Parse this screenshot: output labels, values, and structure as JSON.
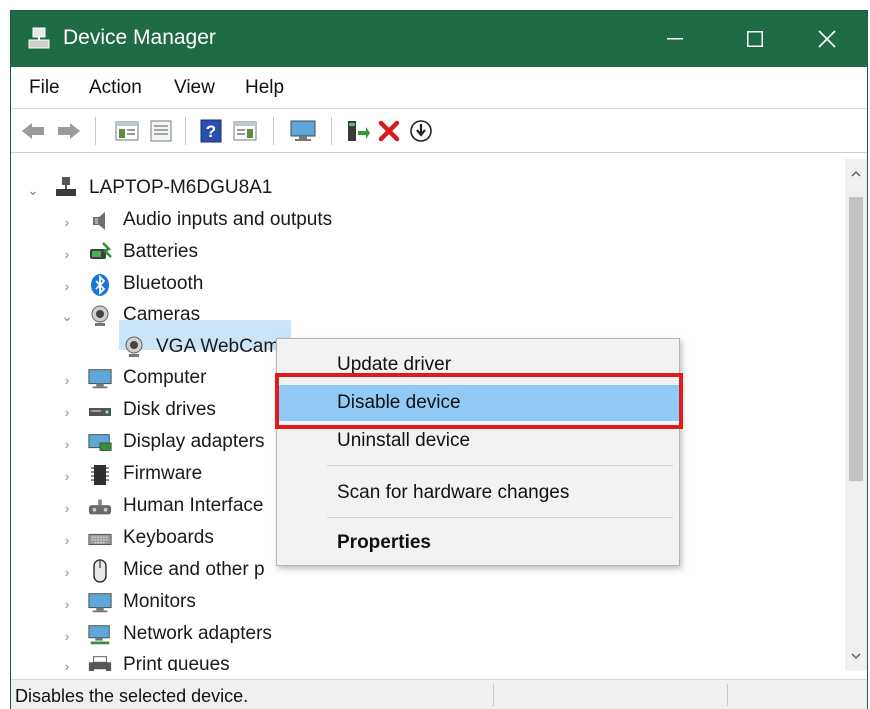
{
  "window": {
    "title": "Device Manager"
  },
  "menubar": {
    "items": [
      "File",
      "Action",
      "View",
      "Help"
    ]
  },
  "toolbar": {
    "buttons": [
      "back-icon",
      "forward-icon",
      "show-hide-console-tree-icon",
      "properties-icon",
      "help-icon",
      "action-pane-icon",
      "monitor-icon",
      "update-driver-icon",
      "uninstall-icon",
      "disable-icon"
    ]
  },
  "tree": {
    "root": "LAPTOP-M6DGU8A1",
    "items": [
      {
        "label": "Audio inputs and outputs",
        "icon": "speaker-icon"
      },
      {
        "label": "Batteries",
        "icon": "battery-icon"
      },
      {
        "label": "Bluetooth",
        "icon": "bluetooth-icon"
      },
      {
        "label": "Cameras",
        "icon": "camera-icon",
        "expanded": true
      },
      {
        "label": "VGA WebCam",
        "icon": "webcam-icon",
        "selected": true
      },
      {
        "label": "Computer",
        "icon": "computer-icon"
      },
      {
        "label": "Disk drives",
        "icon": "disk-icon"
      },
      {
        "label": "Display adapters",
        "icon": "display-adapter-icon"
      },
      {
        "label": "Firmware",
        "icon": "firmware-icon"
      },
      {
        "label": "Human Interface",
        "icon": "hid-icon"
      },
      {
        "label": "Keyboards",
        "icon": "keyboard-icon"
      },
      {
        "label": "Mice and other p",
        "icon": "mouse-icon"
      },
      {
        "label": "Monitors",
        "icon": "monitor-icon"
      },
      {
        "label": "Network adapters",
        "icon": "network-icon"
      },
      {
        "label": "Print queues",
        "icon": "printer-icon"
      }
    ]
  },
  "context_menu": {
    "items": [
      "Update driver",
      "Disable device",
      "Uninstall device",
      "Scan for hardware changes",
      "Properties"
    ],
    "highlighted": "Disable device"
  },
  "status": {
    "text": "Disables the selected device."
  },
  "colors": {
    "titlebar": "#1f6b46",
    "menu_highlight": "#91c9f7",
    "annotation_box": "#e01b1b",
    "selection": "#cce4f7"
  }
}
